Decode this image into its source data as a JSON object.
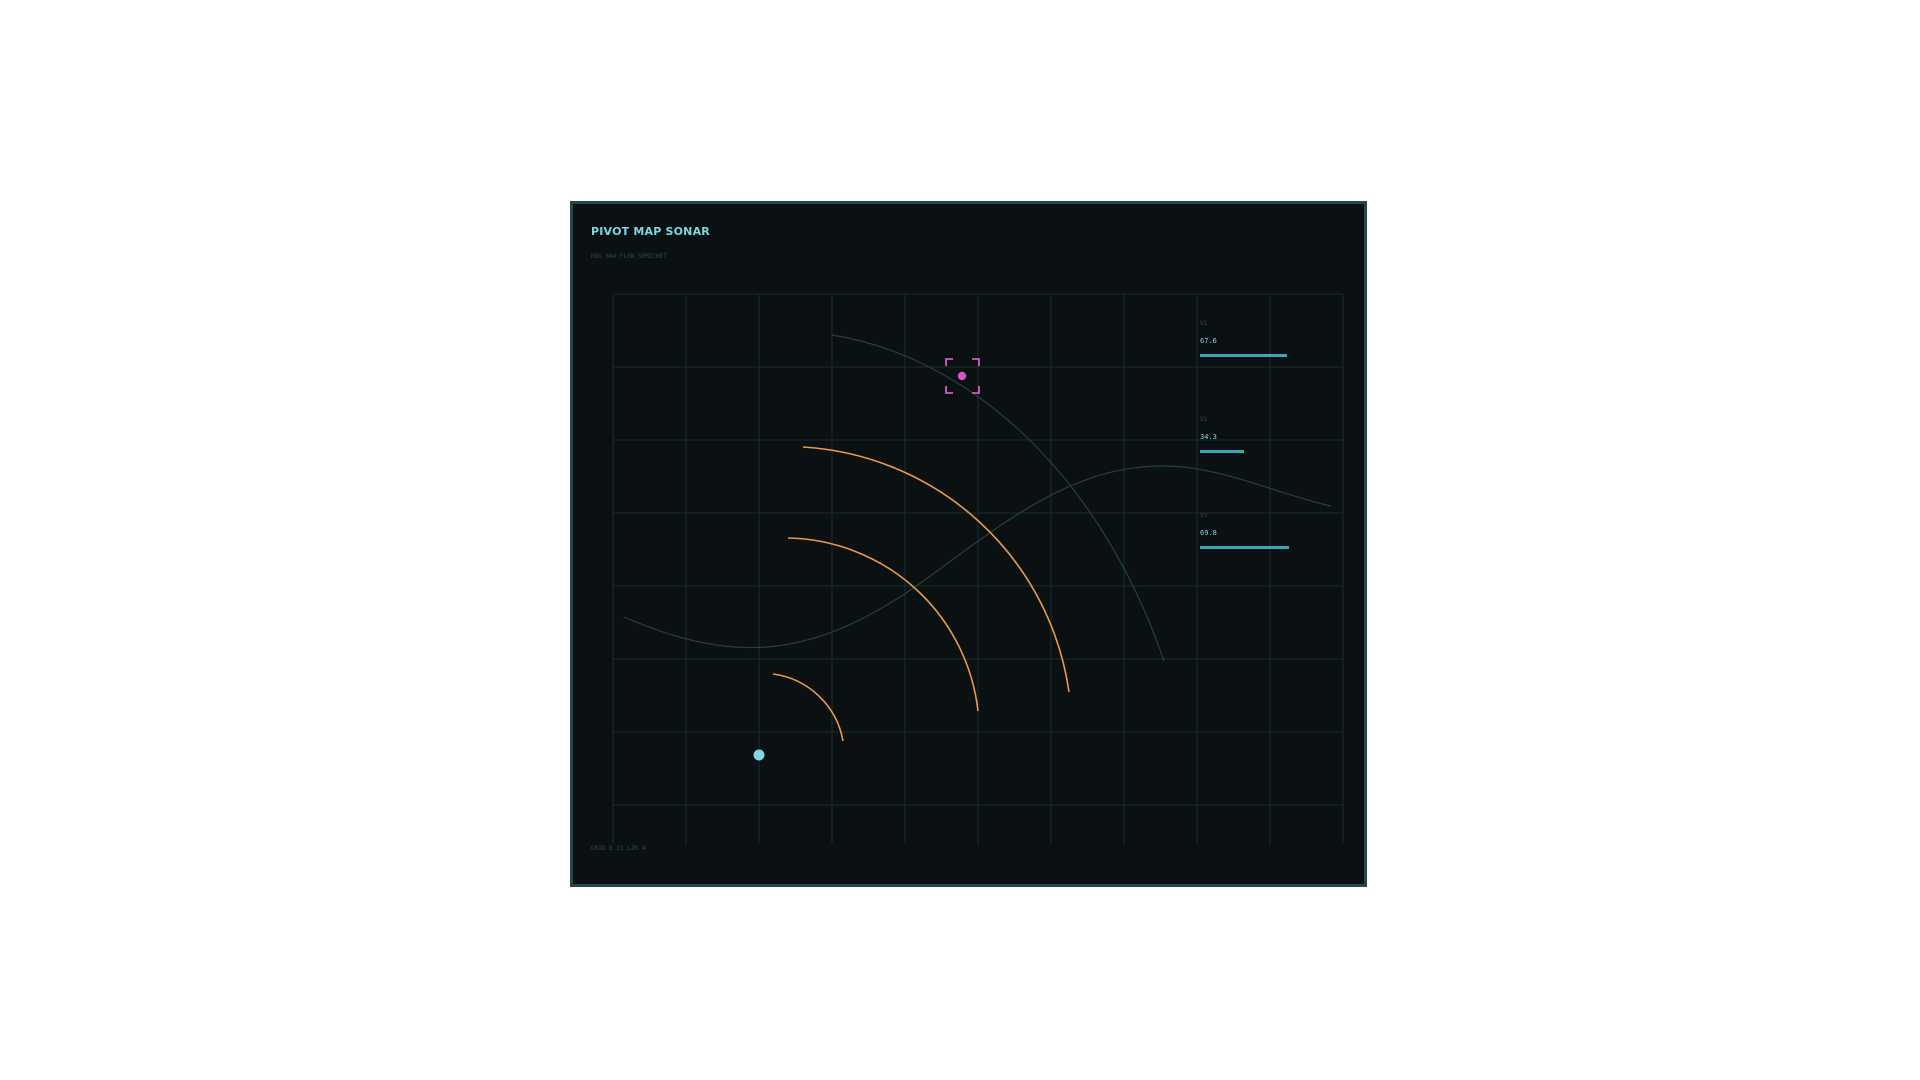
{
  "header": {
    "title": "PIVOT MAP SONAR",
    "subtitle": "HDG 084 FLOW SEMICHET"
  },
  "footer": {
    "text": "GRID 8.23 LZR 4"
  },
  "metrics": [
    {
      "label": "V1",
      "value": "67.6",
      "level": 0.676
    },
    {
      "label": "V2",
      "value": "34.3",
      "level": 0.343
    },
    {
      "label": "V3",
      "value": "69.8",
      "level": 0.698
    }
  ],
  "colors": {
    "background": "#0b1112",
    "border": "#28474d",
    "grid": "#1a2b2d",
    "accent": "#7fd6e0",
    "bar": "#3aa8b3",
    "arc": "#e89a4a",
    "target": "#d856c4",
    "curve": "#23403f"
  },
  "icons": {
    "player": "player-dot-icon",
    "target": "target-reticle-icon"
  }
}
